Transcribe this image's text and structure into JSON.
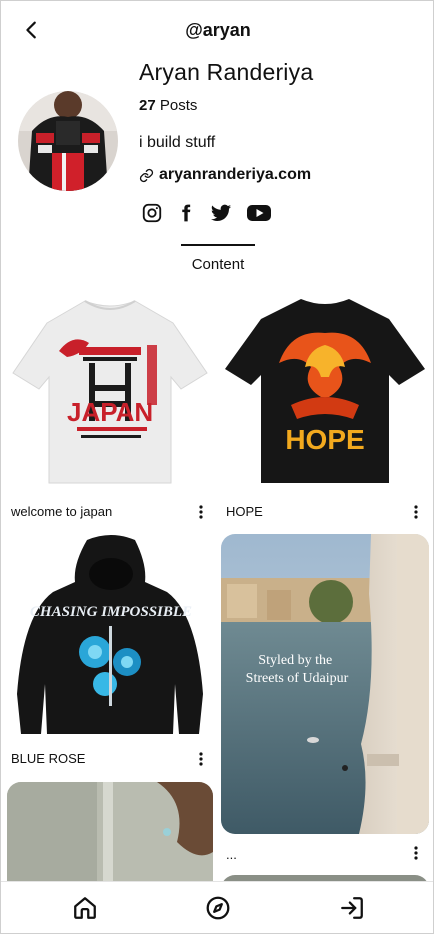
{
  "header": {
    "handle": "@aryan"
  },
  "profile": {
    "name": "Aryan Randeriya",
    "posts_count": "27",
    "posts_label": "Posts",
    "bio": "i build stuff",
    "website": "aryanranderiya.com",
    "socials": [
      "instagram-icon",
      "facebook-icon",
      "twitter-icon",
      "youtube-icon"
    ]
  },
  "tabs": {
    "content": "Content"
  },
  "posts": [
    {
      "caption": "welcome to japan",
      "image_text": "JAPAN"
    },
    {
      "caption": "HOPE",
      "image_text": "HOPE"
    },
    {
      "caption": "BLUE ROSE",
      "image_text": "CHASING IMPOSSIBLE"
    },
    {
      "caption": "...",
      "image_text": "Styled by the Streets of Udaipur"
    }
  ],
  "nav": [
    "home-icon",
    "explore-icon",
    "login-icon"
  ],
  "colors": {
    "text": "#111111",
    "accent": "#111111",
    "background": "#ffffff"
  }
}
